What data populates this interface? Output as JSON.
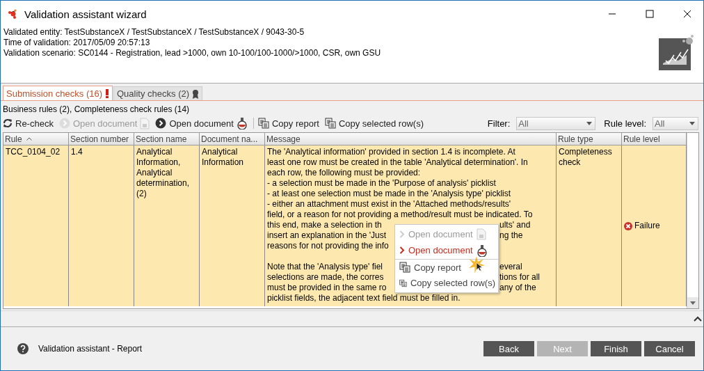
{
  "window": {
    "title": "Validation assistant wizard"
  },
  "info": [
    "Validated entity: TestSubstanceX / TestSubstanceX / TestSubstanceX / 9043-30-5",
    "Time of validation: 2017/05/09 20:57:13",
    "Validation scenario: SC0144 - Registration, lead >1000, own 10-100/100-1000/>1000, CSR, own GSU"
  ],
  "tabs": [
    {
      "label": "Submission checks (16)",
      "selected": true
    },
    {
      "label": "Quality checks (2)",
      "selected": false
    }
  ],
  "summary": "Business rules (2), Completeness check rules (14)",
  "toolbar": [
    {
      "label": "Re-check",
      "kind": "recheck",
      "disabled": false,
      "separator_before": false
    },
    {
      "label": "Open document",
      "kind": "dossier",
      "disabled": true,
      "separator_before": false
    },
    {
      "label": "Open document",
      "kind": "substance",
      "disabled": false,
      "separator_before": false
    },
    {
      "label": "Copy report",
      "kind": "copy",
      "disabled": false,
      "separator_before": true
    },
    {
      "label": "Copy selected row(s)",
      "kind": "copy",
      "disabled": false,
      "separator_before": false
    }
  ],
  "filters": [
    {
      "label": "Filter:",
      "value": "All"
    },
    {
      "label": "Rule level:",
      "value": "All"
    }
  ],
  "table": {
    "columns": [
      {
        "label": "Rule",
        "sorted": true
      },
      {
        "label": "Section number",
        "sorted": false
      },
      {
        "label": "Section name",
        "sorted": false
      },
      {
        "label": "Document na...",
        "sorted": false
      },
      {
        "label": "Message",
        "sorted": false
      },
      {
        "label": "Rule type",
        "sorted": false
      },
      {
        "label": "Rule level",
        "sorted": false
      }
    ],
    "rows": [
      {
        "selected": true,
        "rule": "TCC_0104_02",
        "section_number": "1.4",
        "section_name": "Analytical Information, Analytical determination, (2)",
        "document_name": "Analytical Information",
        "message": [
          [
            {
              "text": "The 'Analytical information' provided in section 1.4 is incomplete. At"
            },
            {
              "text": "least one row must be created in the table 'Analytical determination'. In"
            },
            {
              "text": "each row, the following must be provided:"
            },
            {
              "text": "- a selection must be made in the 'Purpose of analysis' picklist"
            },
            {
              "text": "- at least one selection must be made in the 'Analysis type' picklist"
            },
            {
              "text": "- either an attachment must exist in the 'Attached methods/results'"
            },
            {
              "text": "field, or a reason for not providing a method/result must be indicated. To"
            },
            {
              "text": "this end, make a selection in th",
              "right": "ults' and"
            },
            {
              "text": "insert an explanation in the 'Just",
              "right": "ng the"
            },
            {
              "text": "reasons for not providing the info"
            }
          ],
          [
            {
              "text": "Note that the 'Analysis type' fiel",
              "right": "everal"
            },
            {
              "text": "selections are made, the corres",
              "right": "tions for all"
            },
            {
              "text": "must be provided in the same ro",
              "right": "any of the"
            },
            {
              "text": "picklist fields, the adjacent text field must be filled in."
            }
          ]
        ],
        "rule_type": "Completeness check",
        "rule_level": {
          "label": "Failure",
          "kind": "failure"
        }
      }
    ]
  },
  "context_menu": {
    "items": [
      {
        "label": "Open document",
        "kind": "dossier",
        "disabled": true,
        "highlighted": false,
        "separator_before": false
      },
      {
        "label": "Open document",
        "kind": "substance",
        "disabled": false,
        "highlighted": true,
        "separator_before": false
      },
      {
        "label": "Copy report",
        "kind": "copy",
        "disabled": false,
        "highlighted": false,
        "separator_before": true
      },
      {
        "label": "Copy selected row(s)",
        "kind": "copy",
        "disabled": false,
        "highlighted": false,
        "separator_before": false
      }
    ]
  },
  "footer": {
    "help_text": "Validation assistant - Report",
    "buttons": [
      {
        "label": "Back",
        "disabled": false
      },
      {
        "label": "Next",
        "disabled": true
      },
      {
        "label": "Finish",
        "disabled": false
      },
      {
        "label": "Cancel",
        "disabled": false
      }
    ]
  }
}
